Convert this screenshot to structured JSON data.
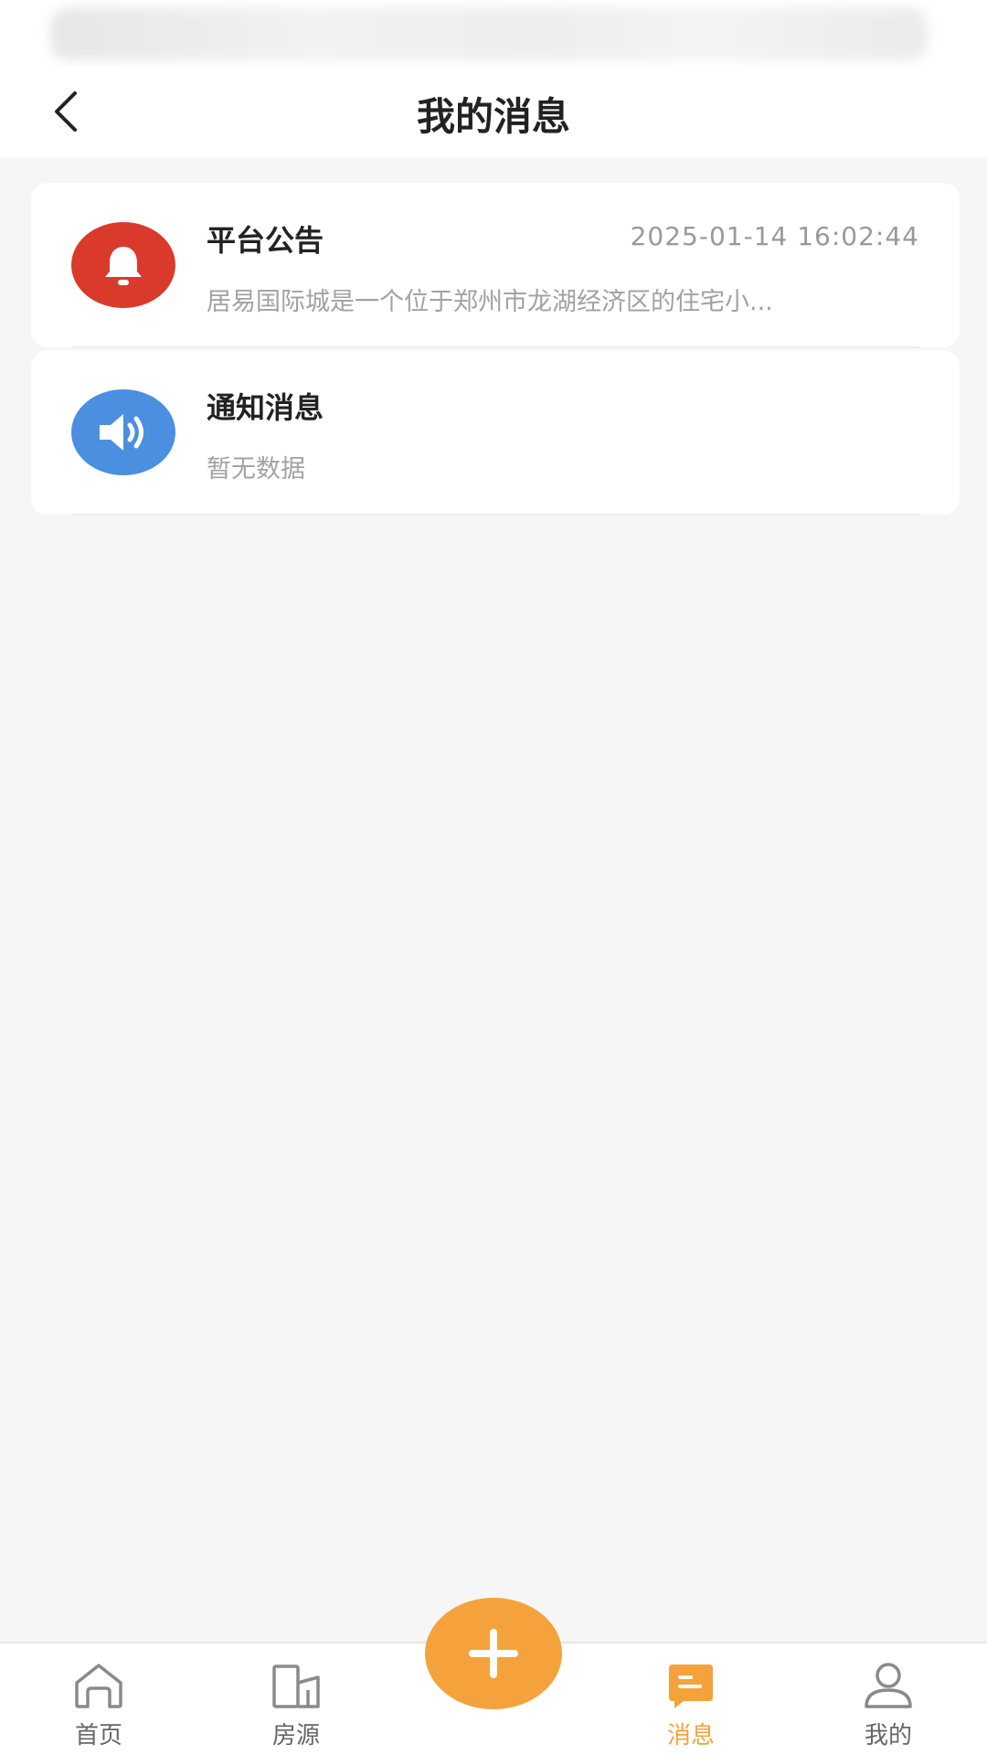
{
  "header": {
    "title": "我的消息"
  },
  "messages": [
    {
      "title": "平台公告",
      "time": "2025-01-14 16:02:44",
      "desc": "居易国际城是一个位于郑州市龙湖经济区的住宅小...",
      "icon": "bell-icon",
      "icon_color": "#d93a2b"
    },
    {
      "title": "通知消息",
      "time": "",
      "desc": "暂无数据",
      "icon": "speaker-icon",
      "icon_color": "#4a8fe0"
    }
  ],
  "tabbar": {
    "items": [
      {
        "label": "首页",
        "icon": "home-icon",
        "active": false
      },
      {
        "label": "房源",
        "icon": "building-icon",
        "active": false
      },
      {
        "label": "消息",
        "icon": "message-icon",
        "active": true
      },
      {
        "label": "我的",
        "icon": "user-icon",
        "active": false
      }
    ],
    "center_button_icon": "plus-icon",
    "accent_color": "#f5a23c"
  }
}
